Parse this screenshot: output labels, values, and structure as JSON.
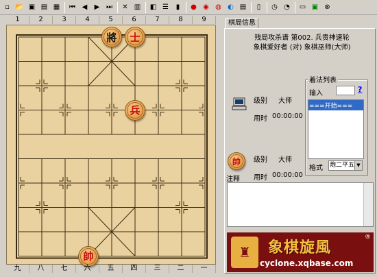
{
  "toolbar": {
    "icons": [
      "new-doc",
      "open-folder",
      "save",
      "save-as",
      "print",
      "first",
      "prev",
      "next",
      "last",
      "delete",
      "paste",
      "flip",
      "list",
      "color",
      "red",
      "eye",
      "globe",
      "sheet",
      "book",
      "clock",
      "timer",
      "monitor",
      "screen",
      "close"
    ]
  },
  "board": {
    "top_numbers": [
      "1",
      "2",
      "3",
      "4",
      "5",
      "6",
      "7",
      "8",
      "9"
    ],
    "bottom_numbers": [
      "九",
      "八",
      "七",
      "六",
      "五",
      "四",
      "三",
      "二",
      "一"
    ],
    "pieces": [
      {
        "name": "black-general",
        "char": "將",
        "side": "black",
        "file": 4,
        "rank": 0
      },
      {
        "name": "red-advisor",
        "char": "士",
        "side": "red",
        "file": 5,
        "rank": 0
      },
      {
        "name": "red-soldier",
        "char": "兵",
        "side": "red",
        "file": 5,
        "rank": 3
      },
      {
        "name": "red-king",
        "char": "帥",
        "side": "red",
        "file": 3,
        "rank": 9
      }
    ],
    "colors": {
      "line": "#3a2a10",
      "bg": "#ead2a0"
    }
  },
  "panel": {
    "tab_label": "棋局信息",
    "title_line1": "残局攻杀谱 第002. 兵贵神速轮",
    "title_line2": "象棋爱好者 (对) 象棋巫师(大师)",
    "top_player": {
      "level_label": "级别",
      "level_value": "大师",
      "time_label": "用时",
      "time_value": "00:00:00"
    },
    "bottom_player": {
      "avatar": "帥",
      "level_label": "级别",
      "level_value": "大师",
      "time_label": "用时",
      "time_value": "00:00:00"
    },
    "moves_group_title": "着法列表",
    "input_label": "输入",
    "help_link": "?",
    "move_list": [
      "===开始==="
    ],
    "format_label": "格式",
    "format_value": "炮二平五",
    "comment_label": "注释"
  },
  "banner": {
    "title": "象棋旋風",
    "url": "cyclone.xqbase.com",
    "reg": "®"
  }
}
